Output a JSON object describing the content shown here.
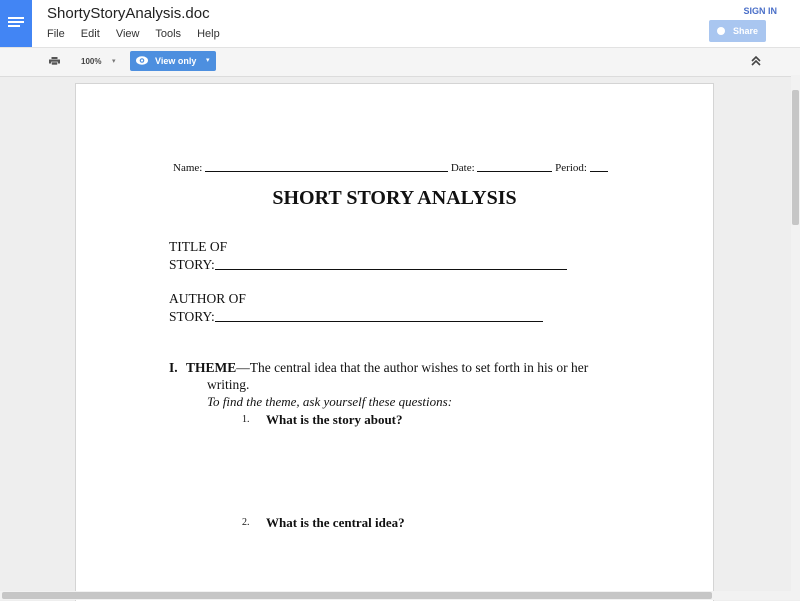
{
  "app": {
    "doc_title": "ShortyStoryAnalysis.doc",
    "menu": [
      "File",
      "Edit",
      "View",
      "Tools",
      "Help"
    ],
    "sign_in": "SIGN IN",
    "share_label": "Share"
  },
  "toolbar": {
    "zoom": "100%",
    "view_mode": "View only"
  },
  "document": {
    "name_label": "Name:",
    "date_label": "Date:",
    "period_label": "Period:",
    "heading": "SHORT STORY ANALYSIS",
    "title_line1": "TITLE OF",
    "title_line2": "STORY:",
    "author_line1": "AUTHOR OF",
    "author_line2": "STORY:",
    "section_number": "I.",
    "section_label": "THEME",
    "section_text_1": "—The central idea that the author wishes to set forth in his or her",
    "section_text_2": "writing.",
    "instruction": "To find the theme, ask yourself these questions:",
    "questions": [
      {
        "number": "1.",
        "text": "What is the story about?"
      },
      {
        "number": "2.",
        "text": "What is the central idea?"
      }
    ]
  },
  "colors": {
    "brand": "#4285f4",
    "view_button": "#4d8fdf",
    "share_button": "#a9c6f0"
  }
}
